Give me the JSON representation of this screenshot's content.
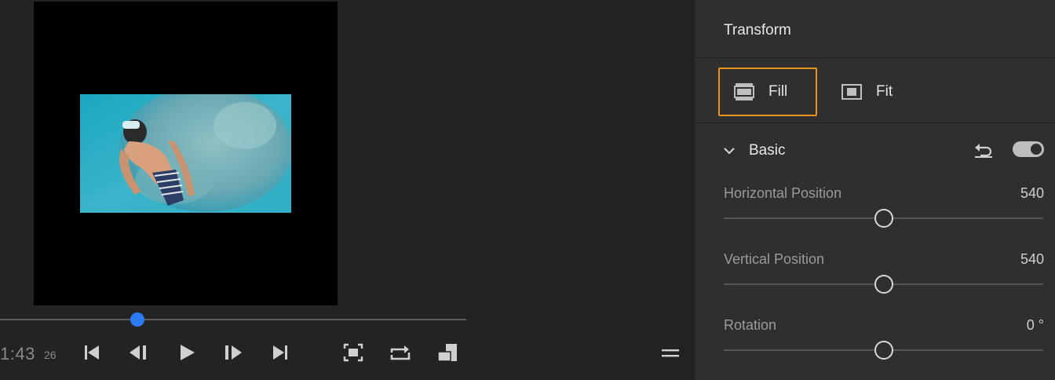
{
  "player": {
    "timecode": "1:43",
    "frames": "26",
    "progress_percent": 29.5,
    "controls": [
      {
        "name": "go-to-start-button",
        "icon": "skip-back-icon"
      },
      {
        "name": "step-back-button",
        "icon": "step-back-icon"
      },
      {
        "name": "play-button",
        "icon": "play-icon"
      },
      {
        "name": "step-forward-button",
        "icon": "step-forward-icon"
      },
      {
        "name": "go-to-end-button",
        "icon": "skip-forward-icon"
      },
      {
        "name": "fit-frame-button",
        "icon": "frame-fit-icon"
      },
      {
        "name": "loop-button",
        "icon": "loop-icon"
      },
      {
        "name": "resolution-button",
        "icon": "resolution-icon"
      }
    ],
    "menu_icon": "hamburger-icon"
  },
  "panel": {
    "title": "Transform",
    "modes": {
      "fill_label": "Fill",
      "fit_label": "Fit",
      "selected": "Fill"
    },
    "section": {
      "title": "Basic",
      "enabled": true
    },
    "properties": [
      {
        "label": "Horizontal Position",
        "value": "540",
        "slider_fraction": 0.5
      },
      {
        "label": "Vertical Position",
        "value": "540",
        "slider_fraction": 0.5
      },
      {
        "label": "Rotation",
        "value": "0 °",
        "slider_fraction": 0.5
      }
    ]
  },
  "colors": {
    "accent_selection": "#e8911c",
    "playhead": "#2d7bf4",
    "panel_bg": "#2f2f2f",
    "app_bg": "#232323"
  }
}
